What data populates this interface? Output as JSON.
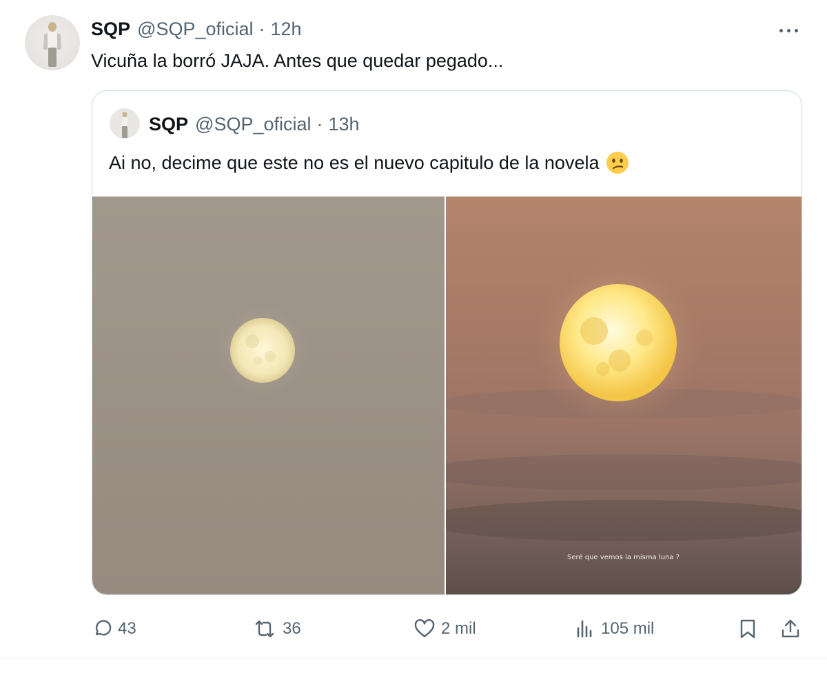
{
  "tweet": {
    "author_name": "SQP",
    "author_handle": "@SQP_oficial",
    "separator": "·",
    "time": "12h",
    "text": "Vicuña la borró JAJA. Antes que quedar pegado..."
  },
  "quoted": {
    "author_name": "SQP",
    "author_handle": "@SQP_oficial",
    "separator": "·",
    "time": "13h",
    "text": "Ai no, decime que este no es el nuevo capitulo de la novela",
    "emoji_icon": "confused-face-icon",
    "image_caption": "Seré que vemos la misma luna ?"
  },
  "actions": {
    "replies": "43",
    "reposts": "36",
    "likes": "2 mil",
    "views": "105 mil"
  },
  "colors": {
    "text_primary": "#0f1419",
    "text_secondary": "#536471",
    "border": "#cfd9de"
  }
}
